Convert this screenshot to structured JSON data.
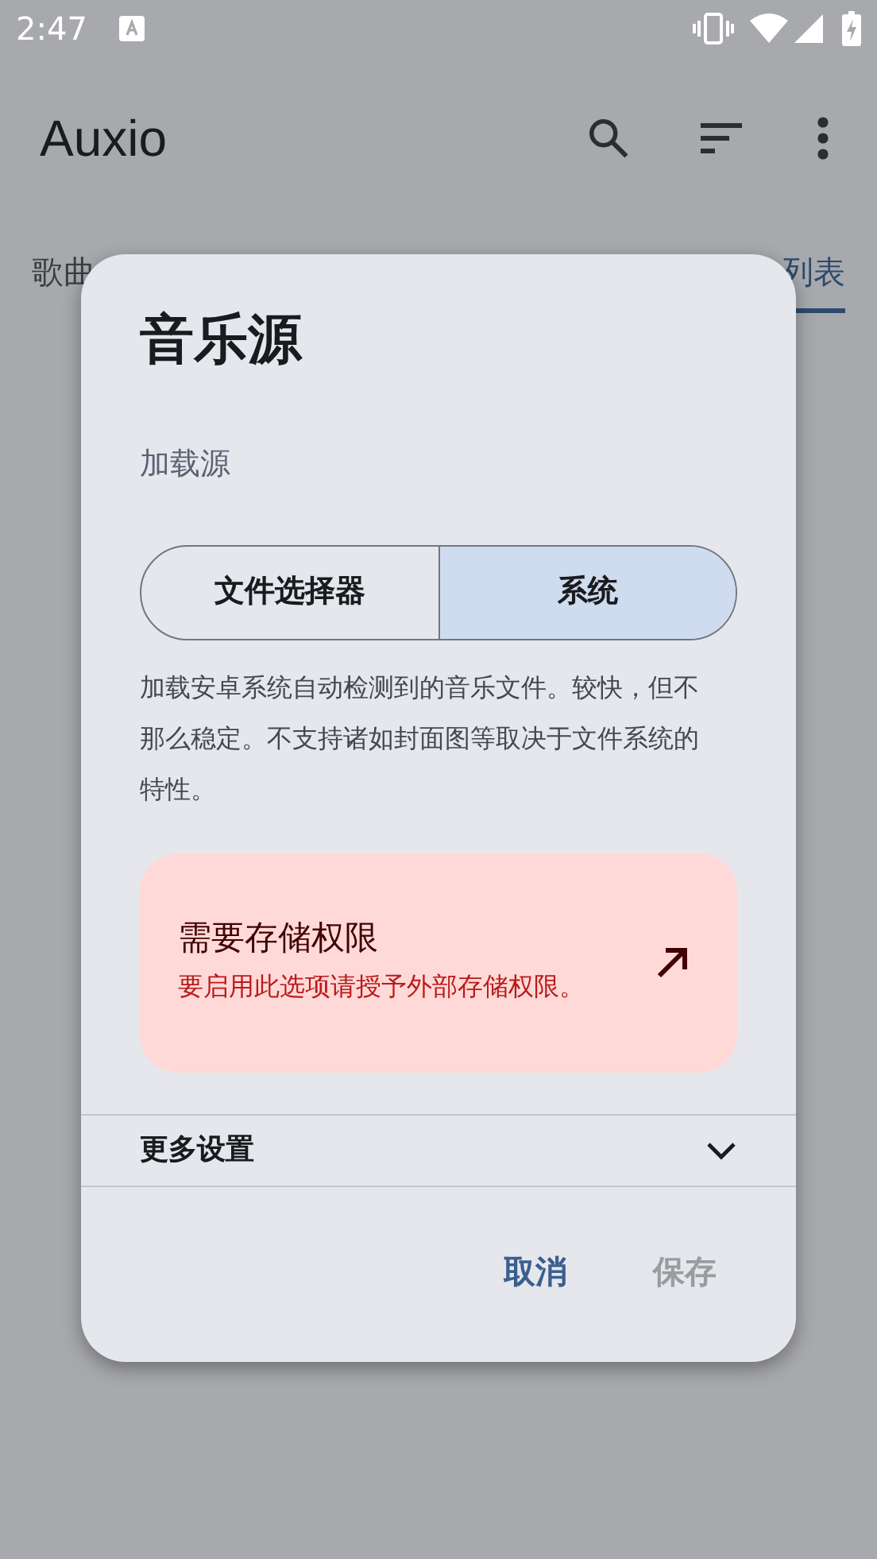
{
  "status_bar": {
    "time": "2:47"
  },
  "app_bar": {
    "title": "Auxio"
  },
  "tabs": [
    {
      "label": "歌曲",
      "selected": false
    },
    {
      "label": "列表",
      "selected": true
    }
  ],
  "dialog": {
    "title": "音乐源",
    "section_label": "加载源",
    "load_options": [
      {
        "label": "文件选择器",
        "selected": false
      },
      {
        "label": "系统",
        "selected": true
      }
    ],
    "description": "加载安卓系统自动检测到的音乐文件。较快，但不那么稳定。不支持诸如封面图等取决于文件系统的特性。",
    "warning": {
      "title": "需要存储权限",
      "message": "要启用此选项请授予外部存储权限。"
    },
    "more_settings": {
      "label": "更多设置",
      "expanded": false
    },
    "buttons": [
      {
        "label": "取消",
        "disabled": false
      },
      {
        "label": "保存",
        "disabled": true
      }
    ]
  }
}
